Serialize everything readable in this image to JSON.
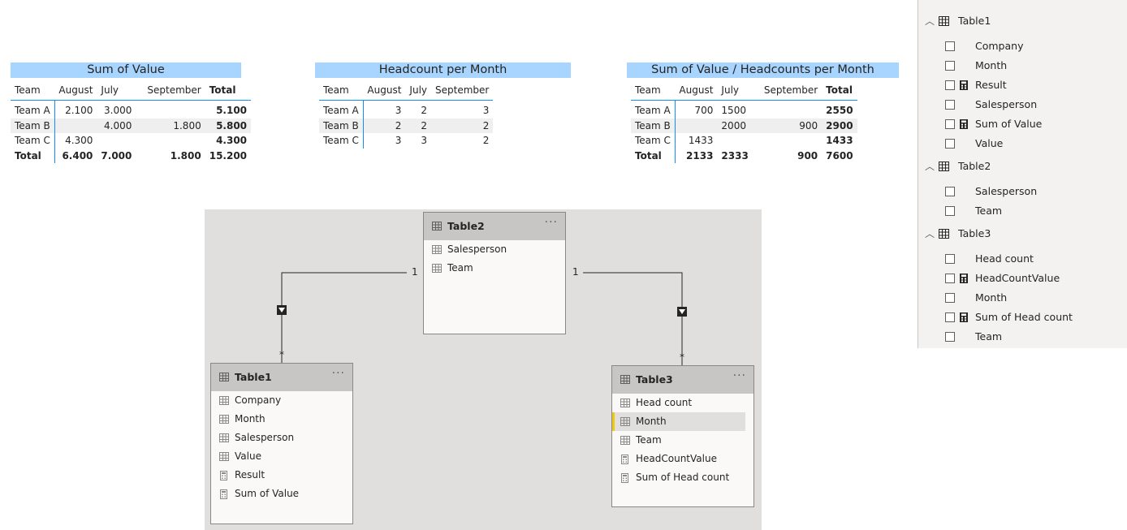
{
  "matrix1": {
    "title": "Sum of Value",
    "headers": [
      "Team",
      "August",
      "July",
      "September",
      "Total"
    ],
    "rows": [
      {
        "team": "Team A",
        "cells": [
          "2.100",
          "3.000",
          "",
          "5.100"
        ]
      },
      {
        "team": "Team B",
        "cells": [
          "",
          "4.000",
          "1.800",
          "5.800"
        ]
      },
      {
        "team": "Team C",
        "cells": [
          "4.300",
          "",
          "",
          "4.300"
        ]
      },
      {
        "team": "Total",
        "cells": [
          "6.400",
          "7.000",
          "1.800",
          "15.200"
        ]
      }
    ]
  },
  "matrix2": {
    "title": "Headcount per Month",
    "headers": [
      "Team",
      "August",
      "July",
      "September"
    ],
    "rows": [
      {
        "team": "Team A",
        "cells": [
          "3",
          "2",
          "3"
        ]
      },
      {
        "team": "Team B",
        "cells": [
          "2",
          "2",
          "2"
        ]
      },
      {
        "team": "Team C",
        "cells": [
          "3",
          "3",
          "2"
        ]
      }
    ]
  },
  "matrix3": {
    "title": "Sum of Value / Headcounts per Month",
    "headers": [
      "Team",
      "August",
      "July",
      "September",
      "Total"
    ],
    "rows": [
      {
        "team": "Team A",
        "cells": [
          "700",
          "1500",
          "",
          "2550"
        ]
      },
      {
        "team": "Team B",
        "cells": [
          "",
          "2000",
          "900",
          "2900"
        ]
      },
      {
        "team": "Team C",
        "cells": [
          "1433",
          "",
          "",
          "1433"
        ]
      },
      {
        "team": "Total",
        "cells": [
          "2133",
          "2333",
          "900",
          "7600"
        ]
      }
    ]
  },
  "diagram": {
    "tables": [
      {
        "name": "Table2",
        "more": "···",
        "fields": [
          {
            "name": "Salesperson",
            "kind": "column"
          },
          {
            "name": "Team",
            "kind": "column"
          }
        ]
      },
      {
        "name": "Table1",
        "more": "···",
        "fields": [
          {
            "name": "Company",
            "kind": "column"
          },
          {
            "name": "Month",
            "kind": "column"
          },
          {
            "name": "Salesperson",
            "kind": "column"
          },
          {
            "name": "Value",
            "kind": "column"
          },
          {
            "name": "Result",
            "kind": "measure"
          },
          {
            "name": "Sum of Value",
            "kind": "measure"
          }
        ]
      },
      {
        "name": "Table3",
        "more": "···",
        "fields": [
          {
            "name": "Head count",
            "kind": "column"
          },
          {
            "name": "Month",
            "kind": "column",
            "selected": true
          },
          {
            "name": "Team",
            "kind": "column"
          },
          {
            "name": "HeadCountValue",
            "kind": "measure"
          },
          {
            "name": "Sum of Head count",
            "kind": "measure"
          }
        ]
      }
    ],
    "relationships": [
      {
        "one_label": "1",
        "many_label": "*"
      },
      {
        "one_label": "1",
        "many_label": "*"
      }
    ],
    "accent_color": "#F2C811"
  },
  "fields_pane": {
    "groups": [
      {
        "name": "Table1",
        "fields": [
          {
            "name": "Company",
            "measure": false
          },
          {
            "name": "Month",
            "measure": false
          },
          {
            "name": "Result",
            "measure": true
          },
          {
            "name": "Salesperson",
            "measure": false
          },
          {
            "name": "Sum of Value",
            "measure": true
          },
          {
            "name": "Value",
            "measure": false
          }
        ]
      },
      {
        "name": "Table2",
        "fields": [
          {
            "name": "Salesperson",
            "measure": false
          },
          {
            "name": "Team",
            "measure": false
          }
        ]
      },
      {
        "name": "Table3",
        "fields": [
          {
            "name": "Head count",
            "measure": false
          },
          {
            "name": "HeadCountValue",
            "measure": true
          },
          {
            "name": "Month",
            "measure": false
          },
          {
            "name": "Sum of Head count",
            "measure": true
          },
          {
            "name": "Team",
            "measure": false
          }
        ]
      }
    ]
  },
  "colors": {
    "title_bar": "#A8D5FF",
    "divider": "#118DFF",
    "row_alt": "#EFEFEF",
    "diagram_bg": "#E1DFDD",
    "card_header": "#C8C6C4"
  }
}
